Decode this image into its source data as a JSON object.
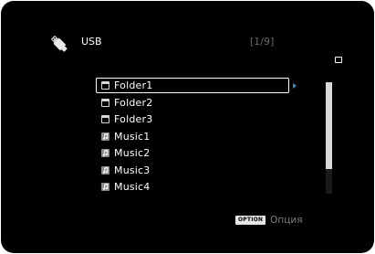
{
  "header": {
    "source_label": "USB",
    "page_counter": "[1/9]",
    "source_icon": "usb-icon"
  },
  "browser": {
    "items": [
      {
        "label": "Folder1",
        "type": "folder",
        "icon": "folder-icon",
        "selected": true
      },
      {
        "label": "Folder2",
        "type": "folder",
        "icon": "folder-icon",
        "selected": false
      },
      {
        "label": "Folder3",
        "type": "folder",
        "icon": "folder-icon",
        "selected": false
      },
      {
        "label": "Music1",
        "type": "music",
        "icon": "music-file-icon",
        "selected": false
      },
      {
        "label": "Music2",
        "type": "music",
        "icon": "music-file-icon",
        "selected": false
      },
      {
        "label": "Music3",
        "type": "music",
        "icon": "music-file-icon",
        "selected": false
      },
      {
        "label": "Music4",
        "type": "music",
        "icon": "music-file-icon",
        "selected": false
      }
    ]
  },
  "footer": {
    "option_key": "OPTION",
    "option_label": "Опция"
  },
  "colors": {
    "background": "#000000",
    "text": "#ffffff",
    "muted_text": "#7d7d7d",
    "accent_arrow": "#2f8fd6",
    "scrollbar": "#d9d9d9"
  }
}
